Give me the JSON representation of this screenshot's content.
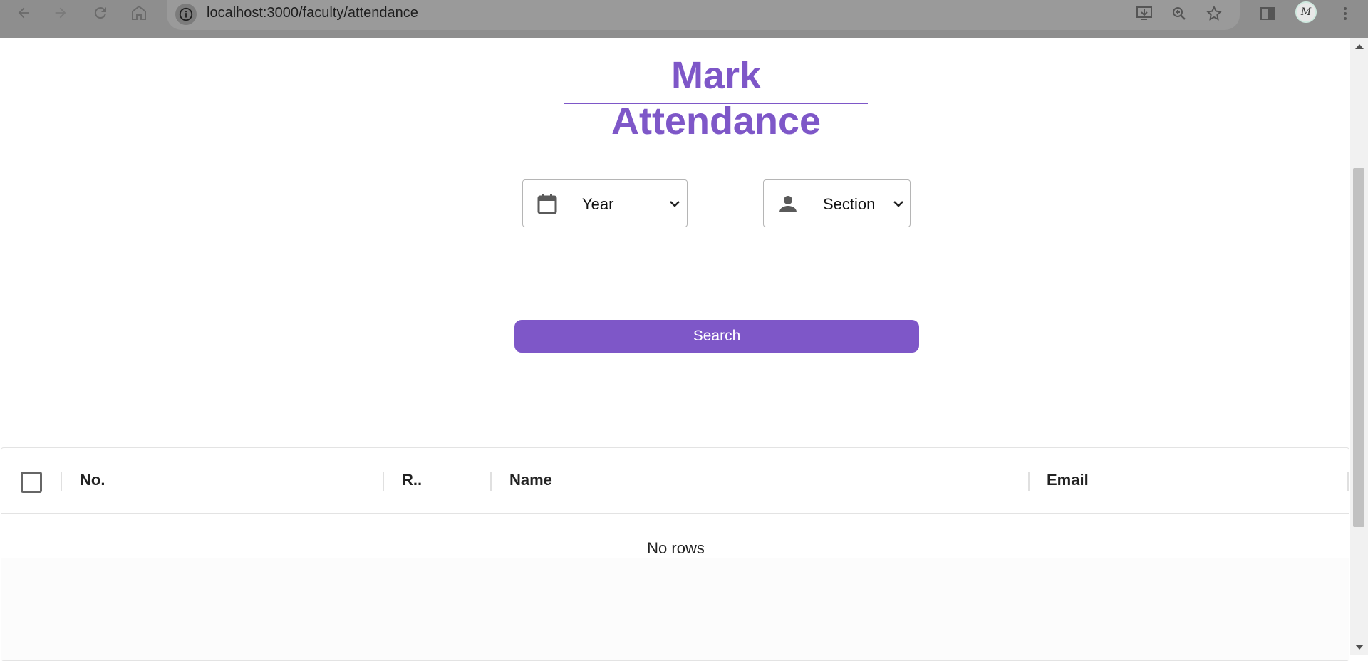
{
  "browser": {
    "url": "localhost:3000/faculty/attendance",
    "icons": [
      "back-arrow-icon",
      "forward-arrow-icon",
      "reload-icon",
      "home-icon",
      "site-info-icon",
      "install-app-icon",
      "zoom-icon",
      "bookmark-star-icon",
      "side-panel-icon",
      "profile-avatar",
      "more-menu-icon"
    ],
    "avatar_initials": "M"
  },
  "page": {
    "title": "Mark Attendance",
    "accent_color": "#7e57c8"
  },
  "filters": {
    "year": {
      "label": "Year",
      "icon": "calendar-icon"
    },
    "section": {
      "label": "Section",
      "icon": "person-icon"
    }
  },
  "search_button": {
    "label": "Search"
  },
  "table": {
    "columns": [
      "No.",
      "R..",
      "Name",
      "Email"
    ],
    "empty_text": "No rows"
  }
}
